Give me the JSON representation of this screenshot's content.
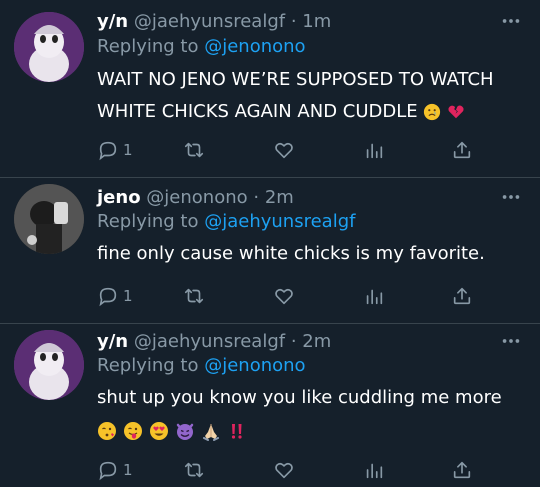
{
  "colors": {
    "background": "#15202b",
    "secondary_text": "#8899a6",
    "accent": "#1da1f2",
    "divider": "#38444d"
  },
  "tweets": [
    {
      "name": "y/n",
      "handle": "@jaehyunsrealgf",
      "separator": "·",
      "time": "1m",
      "replying_prefix": "Replying to",
      "replying_to": "@jenonono",
      "text": "WAIT NO JENO WE’RE SUPPOSED TO WATCH WHITE CHICKS AGAIN AND CUDDLE",
      "emojis": [
        "crying-face",
        "broken-heart"
      ],
      "reply_count": "1"
    },
    {
      "name": "jeno",
      "handle": "@jenonono",
      "separator": "·",
      "time": "2m",
      "replying_prefix": "Replying to",
      "replying_to": "@jaehyunsrealgf",
      "text": "fine only cause white chicks is my favorite.",
      "emojis": [],
      "reply_count": "1"
    },
    {
      "name": "y/n",
      "handle": "@jaehyunsrealgf",
      "separator": "·",
      "time": "2m",
      "replying_prefix": "Replying to",
      "replying_to": "@jenonono",
      "text": "shut up you know you like cuddling me more",
      "emojis": [
        "kissing-face",
        "tongue-face",
        "heart-eyes-face",
        "smiling-imp",
        "folded-hands",
        "double-exclamation"
      ],
      "reply_count": "1"
    }
  ]
}
